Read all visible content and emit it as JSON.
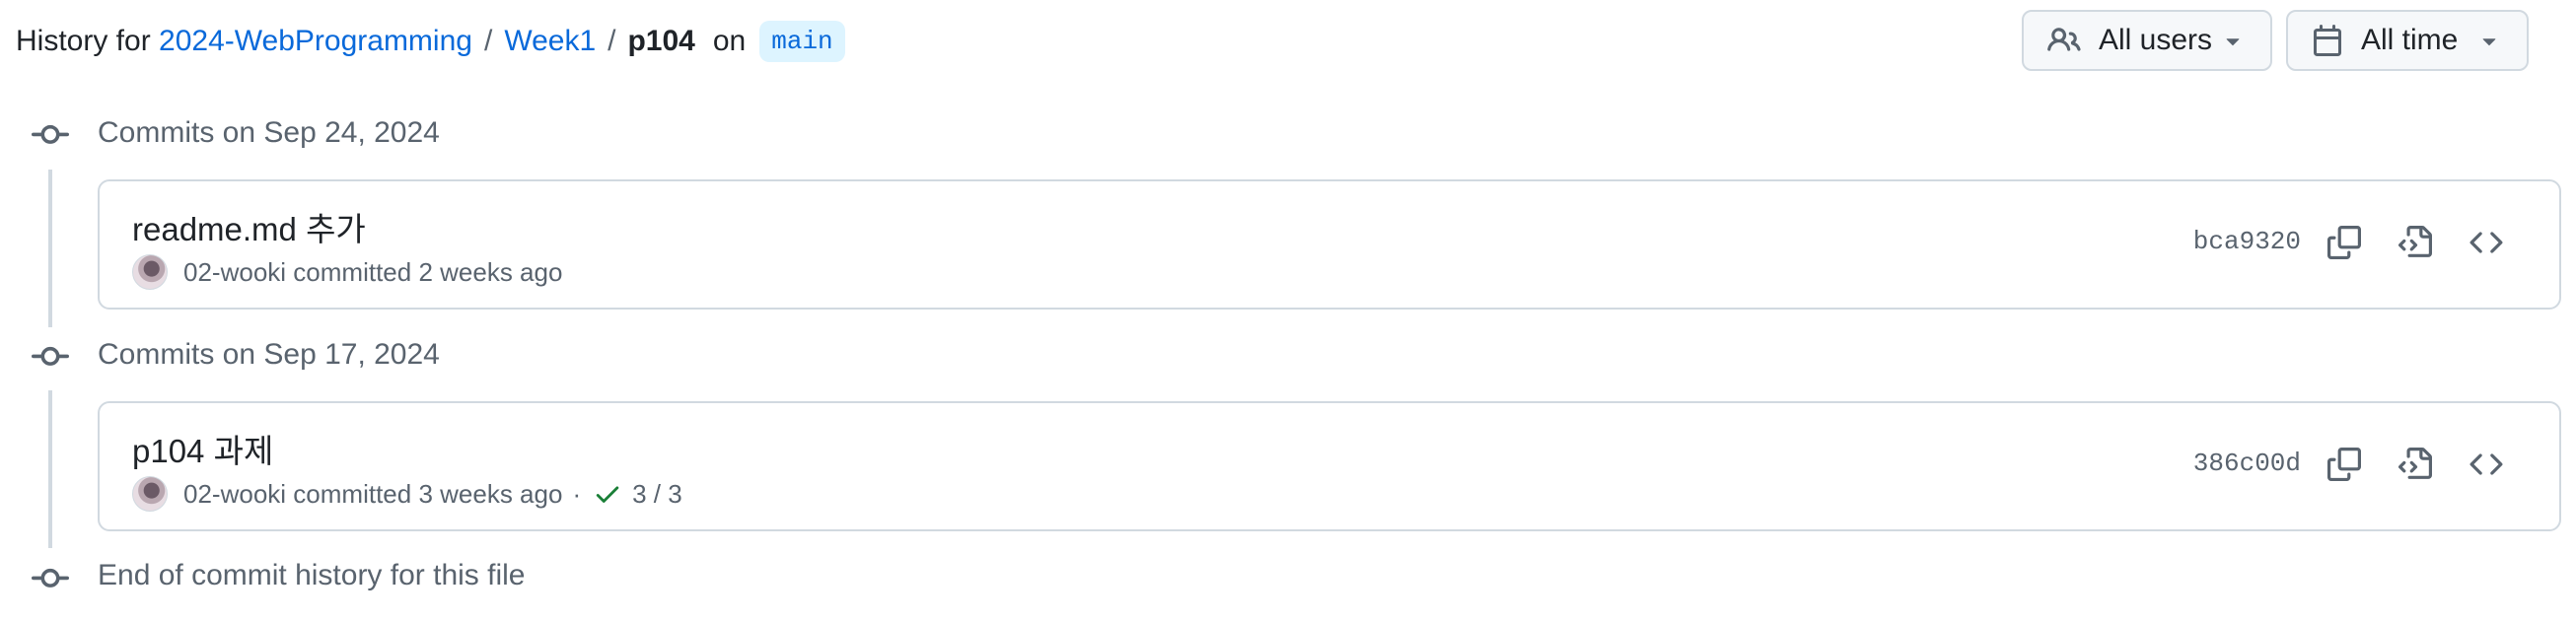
{
  "header": {
    "prefix": "History for",
    "repo": "2024-WebProgramming",
    "folder": "Week1",
    "file": "p104",
    "on": "on",
    "branch": "main"
  },
  "filters": {
    "users_label": "All users",
    "time_label": "All time"
  },
  "groups": [
    {
      "title": "Commits on Sep 24, 2024",
      "commit": {
        "message": "readme.md 추가",
        "author": "02-wooki",
        "committed": "committed",
        "when": "2 weeks ago",
        "sha": "bca9320"
      }
    },
    {
      "title": "Commits on Sep 17, 2024",
      "commit": {
        "message": "p104 과제",
        "author": "02-wooki",
        "committed": "committed",
        "when": "3 weeks ago",
        "separator": "·",
        "checks": "3 / 3",
        "sha": "386c00d"
      }
    }
  ],
  "end_text": "End of commit history for this file",
  "icons": {
    "people": "people-icon",
    "calendar": "calendar-icon",
    "caret": "triangle-down-icon",
    "commit": "git-commit-icon",
    "copy": "copy-icon",
    "file_code": "file-code-icon",
    "code": "code-icon",
    "check": "check-icon"
  },
  "colors": {
    "link": "#0969da",
    "branch_bg": "#ddf4ff",
    "muted": "#59636e",
    "border": "#d1d9e0",
    "success": "#1a7f37"
  }
}
